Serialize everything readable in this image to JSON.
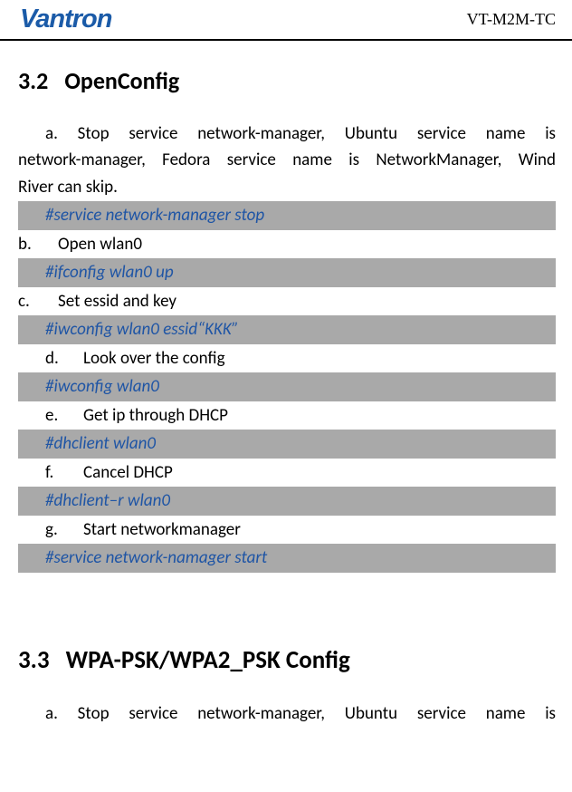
{
  "header": {
    "logo": "Vantron",
    "doc_id": "VT-M2M-TC"
  },
  "section32": {
    "number": "3.2",
    "title": "OpenConfig",
    "items": [
      {
        "marker": "a.",
        "text": "Stop service network-manager, Ubuntu service name is network-manager, Fedora service name is NetworkManager, Wind River can skip.",
        "cmd": "#service network-manager stop"
      },
      {
        "marker": "b.",
        "text": "Open wlan0",
        "cmd": "#ifconfig wlan0 up"
      },
      {
        "marker": "c.",
        "text": "Set essid and key",
        "cmd": "#iwconfig wlan0 essid“KKK”"
      },
      {
        "marker": "d.",
        "text": "Look over the config",
        "cmd": "#iwconfig wlan0"
      },
      {
        "marker": "e.",
        "text": "Get ip through DHCP",
        "cmd": "#dhclient wlan0"
      },
      {
        "marker": "f.",
        "text": "Cancel DHCP",
        "cmd": "#dhclient–r wlan0"
      },
      {
        "marker": "g.",
        "text": "Start networkmanager",
        "cmd": "#service network-namager start"
      }
    ]
  },
  "section33": {
    "number": "3.3",
    "title": "WPA-PSK/WPA2_PSK Config",
    "items": [
      {
        "marker": "a.",
        "text": "Stop service network-manager, Ubuntu service name is"
      }
    ]
  }
}
